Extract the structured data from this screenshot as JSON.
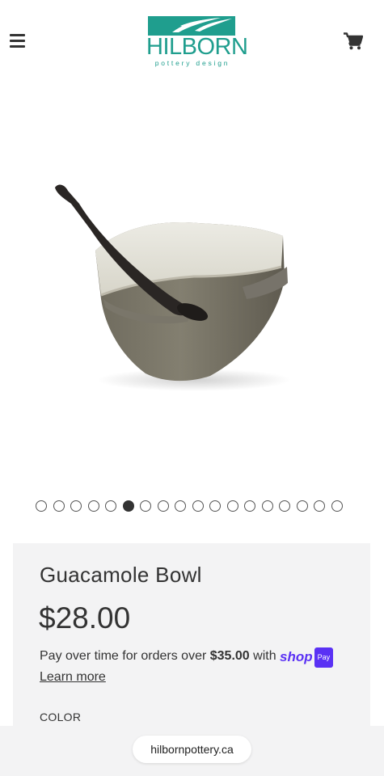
{
  "header": {
    "menu_icon": "hamburger-menu-icon",
    "logo_name": "HILBORN",
    "logo_tagline": "pottery design",
    "cart_icon": "shopping-cart-icon",
    "brand_color": "#1f9e8e"
  },
  "gallery": {
    "image_alt": "Guacamole Bowl with spoon",
    "total_images": 18,
    "active_index": 6
  },
  "product": {
    "title": "Guacamole Bowl",
    "price": "$28.00",
    "shoppay_prefix": "Pay over time for orders over ",
    "shoppay_threshold": "$35.00",
    "shoppay_with": " with ",
    "shop_word": "shop",
    "pay_word": "Pay",
    "learn_more": "Learn more",
    "color_label": "COLOR"
  },
  "browser": {
    "url": "hilbornpottery.ca"
  }
}
